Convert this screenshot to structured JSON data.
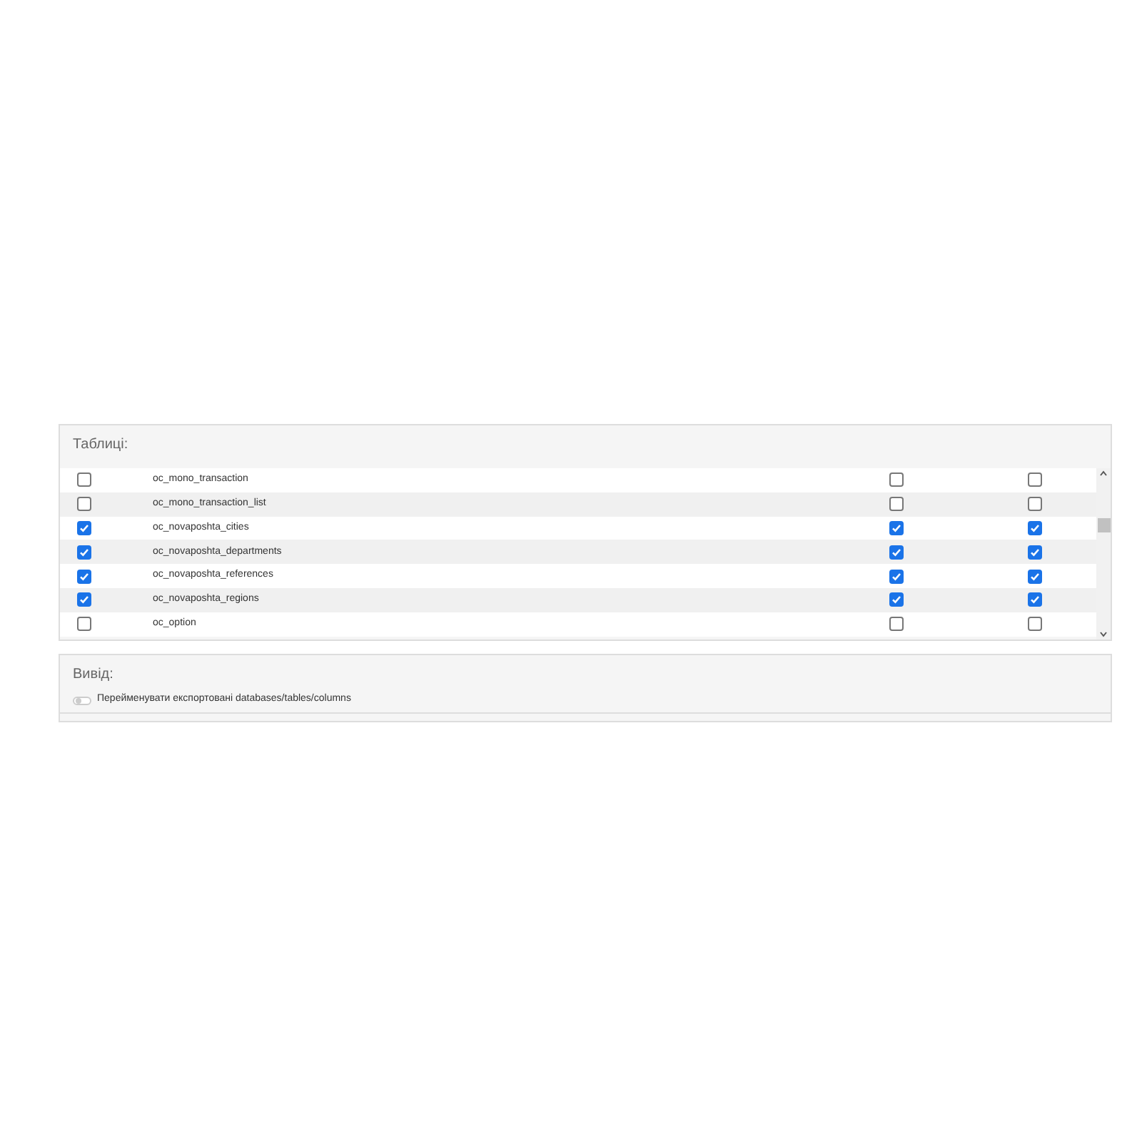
{
  "tables_panel": {
    "title": "Таблиці:",
    "rows": [
      {
        "name": "oc_mono_transaction",
        "selected": false,
        "structure": false,
        "data": false
      },
      {
        "name": "oc_mono_transaction_list",
        "selected": false,
        "structure": false,
        "data": false
      },
      {
        "name": "oc_novaposhta_cities",
        "selected": true,
        "structure": true,
        "data": true
      },
      {
        "name": "oc_novaposhta_departments",
        "selected": true,
        "structure": true,
        "data": true
      },
      {
        "name": "oc_novaposhta_references",
        "selected": true,
        "structure": true,
        "data": true
      },
      {
        "name": "oc_novaposhta_regions",
        "selected": true,
        "structure": true,
        "data": true
      },
      {
        "name": "oc_option",
        "selected": false,
        "structure": false,
        "data": false
      }
    ]
  },
  "output_panel": {
    "title": "Вивід:",
    "rename_toggle": {
      "label": "Перейменувати експортовані databases/tables/columns",
      "on": false
    }
  }
}
